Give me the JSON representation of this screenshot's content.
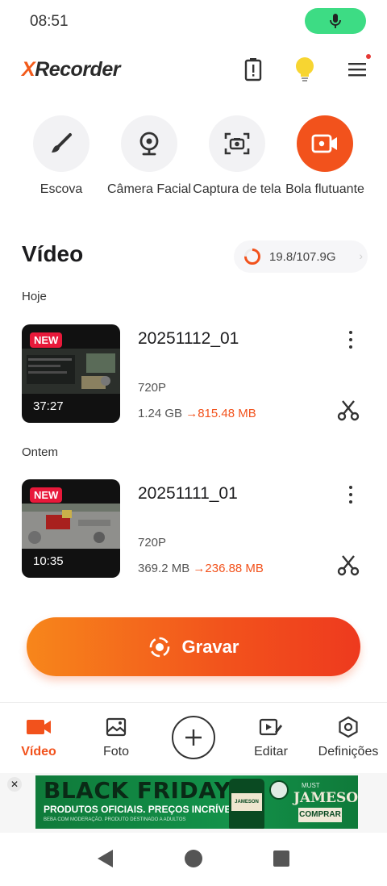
{
  "status_bar": {
    "time": "08:51"
  },
  "header": {
    "logo_x": "X",
    "logo_rest": "Recorder"
  },
  "tools": [
    {
      "label": "Escova",
      "icon": "brush-icon"
    },
    {
      "label": "Câmera Facial",
      "icon": "webcam-icon"
    },
    {
      "label": "Captura de tela",
      "icon": "screenshot-icon"
    },
    {
      "label": "Bola flutuante",
      "icon": "floating-ball-icon"
    }
  ],
  "section": {
    "title": "Vídeo",
    "storage": "19.8/107.9G"
  },
  "groups": [
    {
      "day": "Hoje",
      "video": {
        "badge": "NEW",
        "name": "20251112_01",
        "duration": "37:27",
        "resolution": "720P",
        "size_old": "1.24 GB",
        "arrow": "→",
        "size_new": "815.48 MB"
      }
    },
    {
      "day": "Ontem",
      "video": {
        "badge": "NEW",
        "name": "20251111_01",
        "duration": "10:35",
        "resolution": "720P",
        "size_old": "369.2 MB",
        "arrow": "→",
        "size_new": "236.88 MB"
      }
    }
  ],
  "record_button": {
    "label": "Gravar"
  },
  "bottom_nav": [
    {
      "label": "Vídeo",
      "active": true
    },
    {
      "label": "Foto"
    },
    {
      "label": "Editar"
    },
    {
      "label": "Definições"
    }
  ],
  "ad": {
    "close": "✕",
    "headline": "BLACK FRIDAY",
    "subline": "PRODUTOS OFICIAIS. PREÇOS INCRÍVEIS.",
    "legal": "BEBA COM MODERAÇÃO. PRODUTO DESTINADO A ADULTOS",
    "must": "MUST",
    "brand": "JAMESON",
    "bottle_label": "JAMESON",
    "cta": "COMPRAR",
    "info": "ⓘ"
  },
  "colors": {
    "accent": "#f2521c",
    "badge": "#e8193a",
    "mic_pill": "#3ddc84"
  }
}
